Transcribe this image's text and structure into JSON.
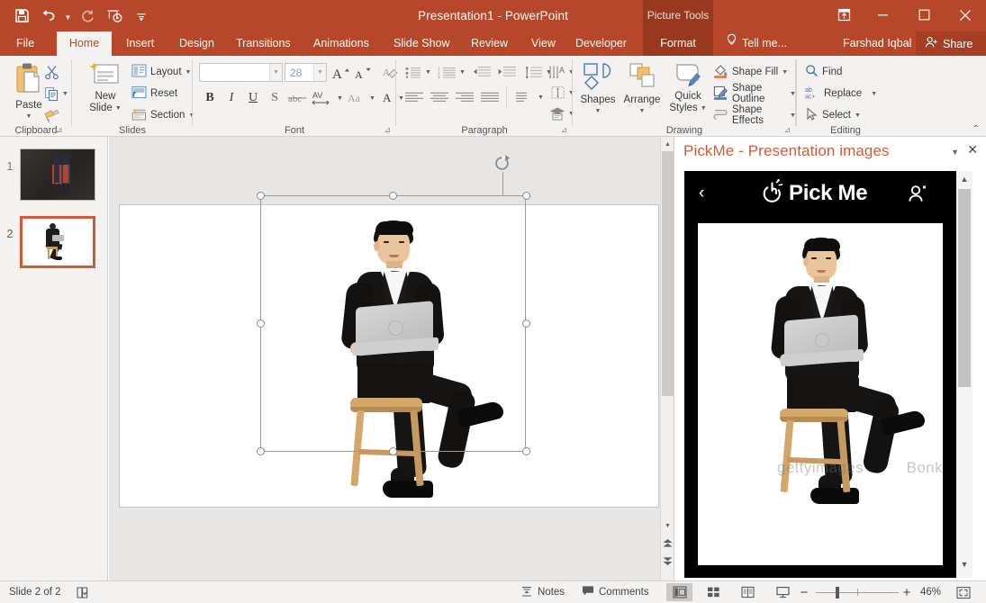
{
  "window": {
    "title": "Presentation1 - PowerPoint",
    "contextual_tab_band": "Picture Tools",
    "quick_access": [
      "save-icon",
      "undo-icon",
      "redo-icon",
      "start-presentation-icon",
      "customize-qat-icon"
    ],
    "controls": {
      "ribbon_display": "ribbon-display-options-icon",
      "minimize": "minimize-icon",
      "maximize": "maximize-icon",
      "close": "close-icon"
    }
  },
  "tabs": [
    {
      "label": "File",
      "active": false
    },
    {
      "label": "Home",
      "active": true
    },
    {
      "label": "Insert",
      "active": false
    },
    {
      "label": "Design",
      "active": false
    },
    {
      "label": "Transitions",
      "active": false
    },
    {
      "label": "Animations",
      "active": false
    },
    {
      "label": "Slide Show",
      "active": false
    },
    {
      "label": "Review",
      "active": false
    },
    {
      "label": "View",
      "active": false
    },
    {
      "label": "Developer",
      "active": false
    },
    {
      "label": "Format",
      "active": false,
      "contextual": true
    }
  ],
  "tellme": {
    "label": "Tell me...",
    "icon": "lightbulb-icon"
  },
  "account": {
    "name": "Farshad Iqbal"
  },
  "share": {
    "label": "Share",
    "icon": "share-person-icon"
  },
  "ribbon": {
    "groups": [
      {
        "name": "Clipboard",
        "label": "Clipboard",
        "paste_label": "Paste",
        "items": [
          "Cut",
          "Copy",
          "Format Painter"
        ]
      },
      {
        "name": "Slides",
        "label": "Slides",
        "new_slide_label": "New\nSlide",
        "new_slide_line1": "New",
        "new_slide_line2": "Slide",
        "layout_label": "Layout",
        "reset_label": "Reset",
        "section_label": "Section"
      },
      {
        "name": "Font",
        "label": "Font",
        "font_name_value": "",
        "font_name_placeholder": "",
        "font_size_value": "28",
        "buttons": [
          "Increase Font Size",
          "Decrease Font Size",
          "Clear All Formatting",
          "Bold",
          "Italic",
          "Underline",
          "Text Shadow",
          "Strikethrough",
          "Character Spacing",
          "Change Case",
          "Font Color"
        ]
      },
      {
        "name": "Paragraph",
        "label": "Paragraph",
        "buttons": [
          "Bullets",
          "Numbering",
          "Decrease List Level",
          "Increase List Level",
          "Line Spacing",
          "Text Direction",
          "Align Text",
          "Convert to SmartArt",
          "Align Left",
          "Center",
          "Align Right",
          "Justify",
          "Columns"
        ]
      },
      {
        "name": "Drawing",
        "label": "Drawing",
        "shapes_label": "Shapes",
        "arrange_label": "Arrange",
        "quick_styles_line1": "Quick",
        "quick_styles_line2": "Styles",
        "shape_fill_label": "Shape Fill",
        "shape_outline_label": "Shape Outline",
        "shape_effects_label": "Shape Effects"
      },
      {
        "name": "Editing",
        "label": "Editing",
        "find_label": "Find",
        "replace_label": "Replace",
        "select_label": "Select"
      }
    ],
    "collapse_icon": "chevron-up-icon"
  },
  "thumbnails": [
    {
      "number": "1",
      "selected": false,
      "description": "graduates-on-chalkboard-slide"
    },
    {
      "number": "2",
      "selected": true,
      "description": "businessman-with-laptop-slide"
    }
  ],
  "slide_canvas": {
    "selected_object": "businessman-with-laptop-image",
    "handles": 8,
    "rotate_handle": "rotate-handle-icon"
  },
  "task_pane": {
    "title": "PickMe - Presentation images",
    "menu_icon": "chevron-down-icon",
    "close_icon": "close-icon",
    "app": {
      "back_icon": "back-chevron-icon",
      "logo_text": "Pick Me",
      "logo_icon": "click-hand-icon",
      "user_icon": "user-account-icon",
      "image_watermark_1": "gettyimages",
      "image_watermark_2": "Bonk"
    }
  },
  "status_bar": {
    "slide_indicator": "Slide 2 of 2",
    "accessibility_icon": "accessibility-check-icon",
    "notes_label": "Notes",
    "notes_icon": "notes-icon",
    "comments_label": "Comments",
    "comments_icon": "comment-icon",
    "views": [
      {
        "name": "normal-view",
        "active": true
      },
      {
        "name": "slide-sorter-view",
        "active": false
      },
      {
        "name": "reading-view",
        "active": false
      },
      {
        "name": "slide-show-view",
        "active": false
      }
    ],
    "zoom_out_icon": "minus-icon",
    "zoom_in_icon": "plus-icon",
    "zoom_level": "46%",
    "fit_icon": "fit-slide-to-window-icon"
  },
  "colors": {
    "accent": "#b7472a",
    "contextual_band": "#98381f",
    "ribbon_bg": "#f3f2f1",
    "canvas_bg": "#e7e6e5",
    "selection_orange": "#d15b35"
  }
}
